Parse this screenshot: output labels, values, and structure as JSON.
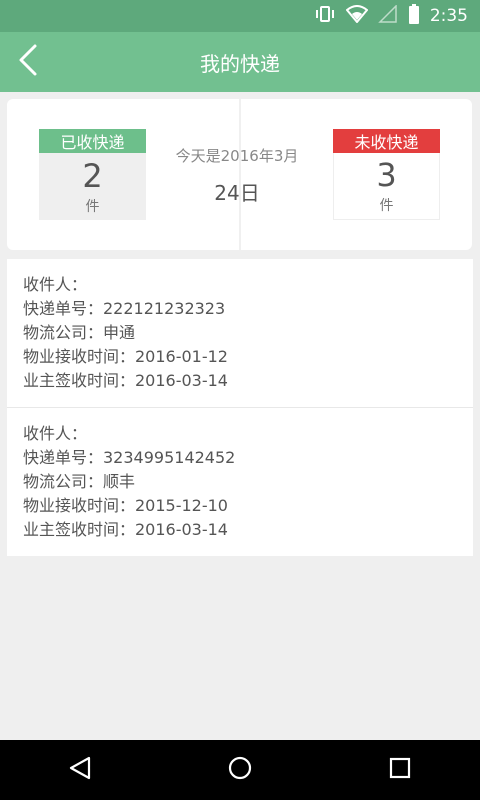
{
  "status": {
    "time": "2:35"
  },
  "appbar": {
    "title": "我的快递"
  },
  "summary": {
    "received": {
      "label": "已收快递",
      "count": "2",
      "unit": "件"
    },
    "unreceived": {
      "label": "未收快递",
      "count": "3",
      "unit": "件"
    },
    "today_label": "今天是2016年3月",
    "day": "24日"
  },
  "packages": [
    {
      "recipient": "收件人：",
      "tracking": "快递单号：222121232323",
      "company": "物流公司：申通",
      "property_received": "物业接收时间：2016-01-12",
      "owner_signed": "业主签收时间：2016-03-14"
    },
    {
      "recipient": "收件人：",
      "tracking": "快递单号：3234995142452",
      "company": "物流公司：顺丰",
      "property_received": "物业接收时间：2015-12-10",
      "owner_signed": "业主签收时间：2016-03-14"
    }
  ],
  "colors": {
    "accent": "#72c090",
    "status_bar": "#5ea97c",
    "received_header": "#6dbf8b",
    "unreceived_header": "#e33e3e"
  },
  "icons": [
    "vibrate-icon",
    "wifi-icon",
    "signal-icon",
    "battery-icon",
    "back-arrow-icon",
    "nav-back-icon",
    "nav-home-icon",
    "nav-recents-icon"
  ]
}
